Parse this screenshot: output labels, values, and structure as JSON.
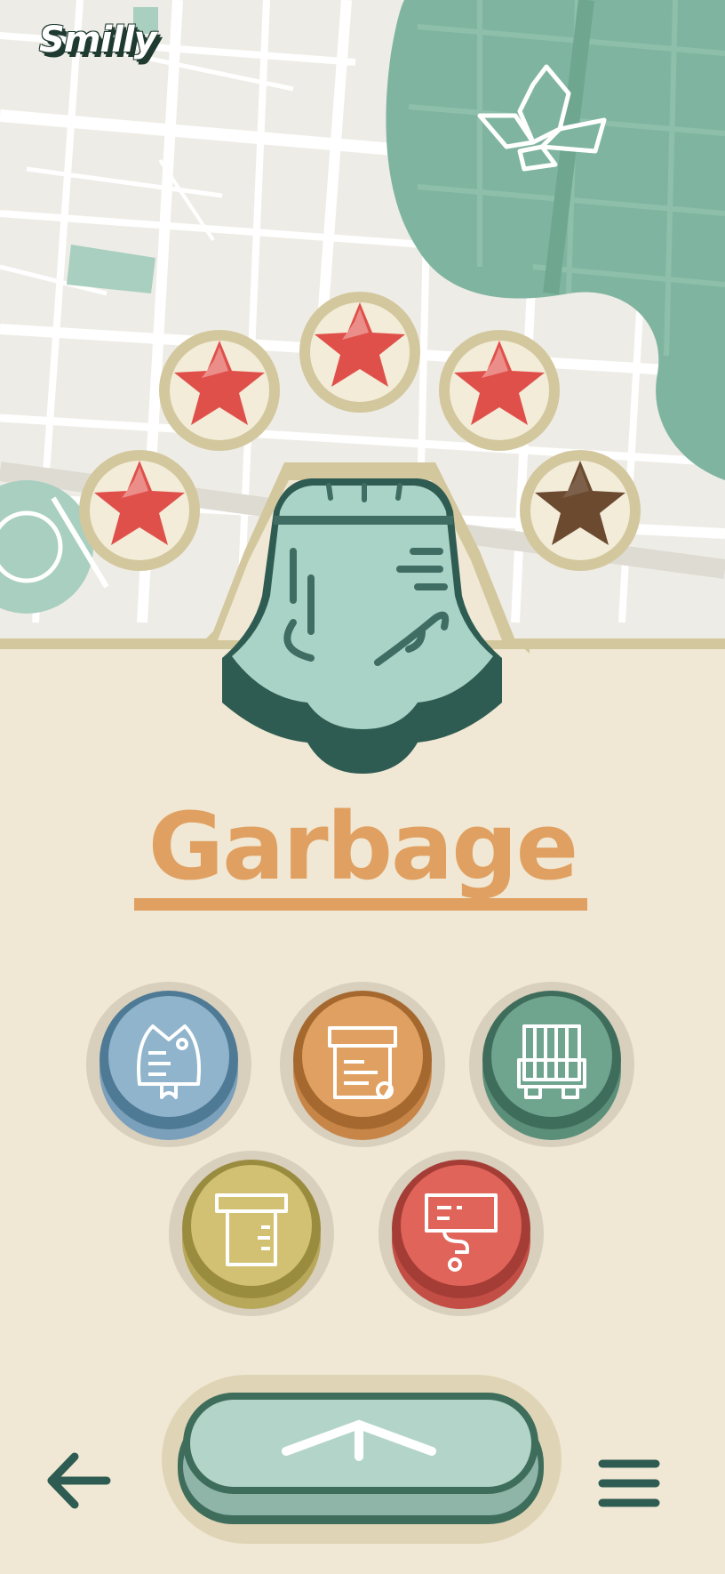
{
  "app": {
    "logo": "Smilly"
  },
  "map": {
    "land_color": "#eeece6",
    "road_color": "#ffffff",
    "park_color": "#a8cfc0",
    "water_color": "#7fb5a0"
  },
  "rating": {
    "value": 4,
    "max": 5,
    "filled_color": "#e0504a",
    "empty_color": "#6b4a30"
  },
  "category": {
    "title": "Garbage",
    "icon": "bell-icon",
    "title_color": "#e0a061"
  },
  "options": [
    {
      "name": "fish-option",
      "icon": "fish-bone-icon",
      "color": "#8fb4cc",
      "rim": "#4f7a96"
    },
    {
      "name": "paper-option",
      "icon": "paper-bin-icon",
      "color": "#e0a061",
      "rim": "#a5692f"
    },
    {
      "name": "truck-option",
      "icon": "garbage-truck-icon",
      "color": "#6fa48e",
      "rim": "#3f6d5c"
    },
    {
      "name": "container-option",
      "icon": "bin-icon",
      "color": "#d2c172",
      "rim": "#9a8c3e"
    },
    {
      "name": "question-option",
      "icon": "question-sign-icon",
      "color": "#e0645a",
      "rim": "#a43d36"
    }
  ],
  "nav": {
    "back_icon": "arrow-left-icon",
    "up_icon": "chevron-up-icon",
    "menu_icon": "hamburger-menu-icon"
  }
}
